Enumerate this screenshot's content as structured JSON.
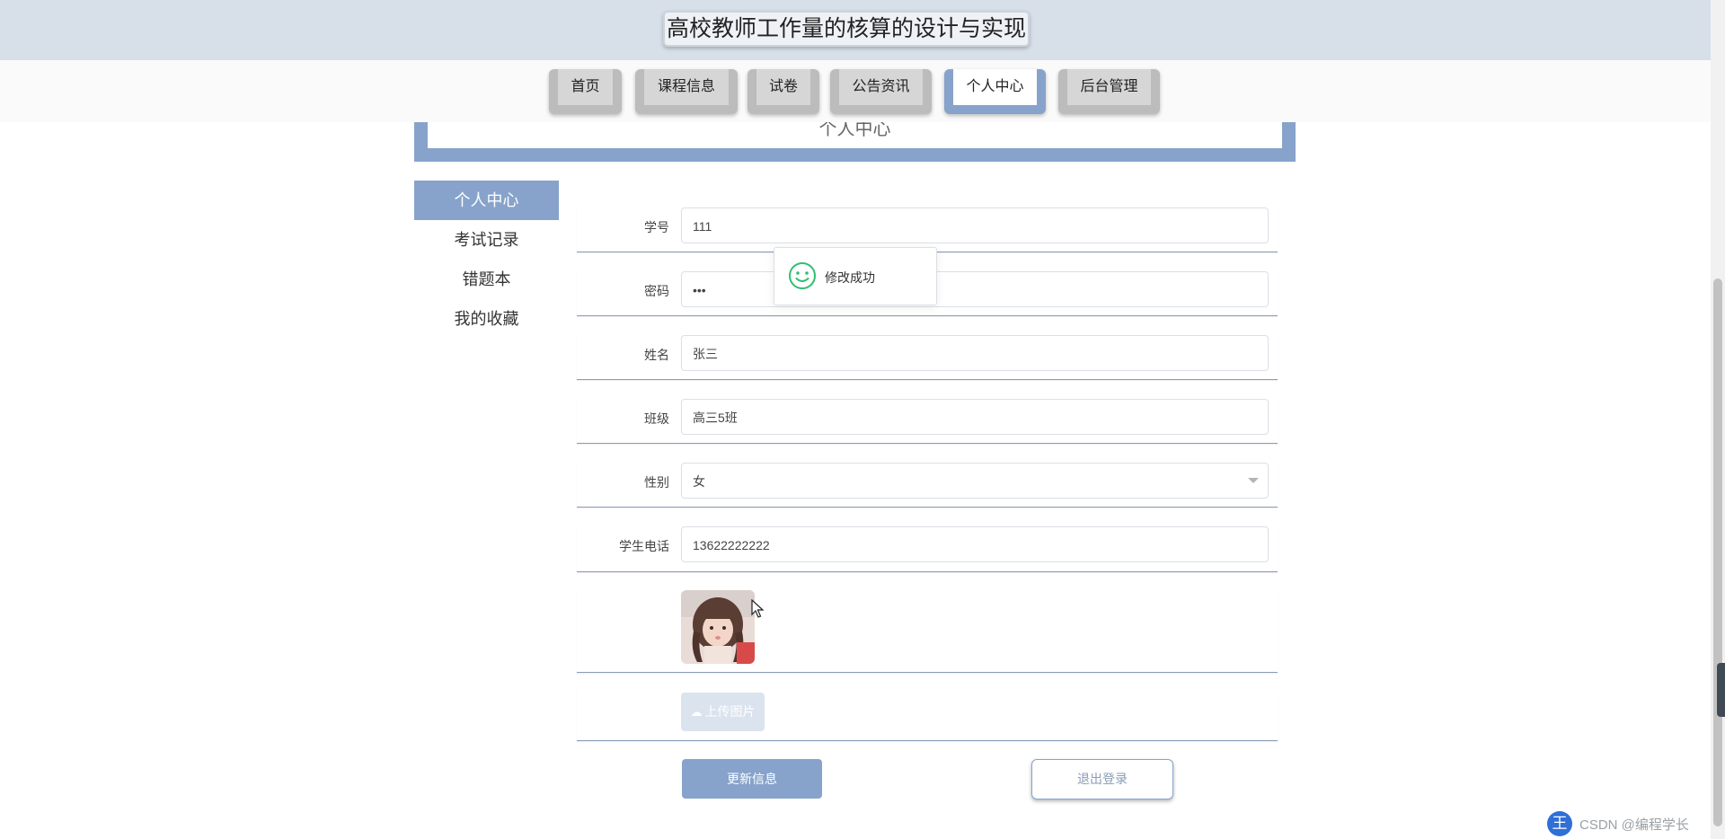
{
  "header": {
    "site_title": "高校教师工作量的核算的设计与实现"
  },
  "nav": {
    "items": [
      {
        "label": "首页"
      },
      {
        "label": "课程信息"
      },
      {
        "label": "试卷"
      },
      {
        "label": "公告资讯"
      },
      {
        "label": "个人中心",
        "active": true
      },
      {
        "label": "后台管理"
      }
    ]
  },
  "banner": {
    "text": "个人中心"
  },
  "side_menu": {
    "items": [
      {
        "label": "个人中心",
        "active": true
      },
      {
        "label": "考试记录"
      },
      {
        "label": "错题本"
      },
      {
        "label": "我的收藏"
      }
    ]
  },
  "form": {
    "student_id": {
      "label": "学号",
      "value": "111"
    },
    "password": {
      "label": "密码",
      "value": "•••"
    },
    "name": {
      "label": "姓名",
      "value": "张三"
    },
    "class": {
      "label": "班级",
      "value": "高三5班"
    },
    "gender": {
      "label": "性别",
      "value": "女"
    },
    "phone": {
      "label": "学生电话",
      "value": "13622222222"
    }
  },
  "upload": {
    "label": "上传图片",
    "icon": "cloud-upload-icon"
  },
  "buttons": {
    "update": "更新信息",
    "logout": "退出登录"
  },
  "toast": {
    "message": "修改成功",
    "icon": "smile-icon",
    "color": "#2fbf71"
  },
  "ime": {
    "badge": "王",
    "watermark": "CSDN @编程学长"
  },
  "colors": {
    "accent": "#87a3cb",
    "header_bg": "#d7dfe9"
  }
}
